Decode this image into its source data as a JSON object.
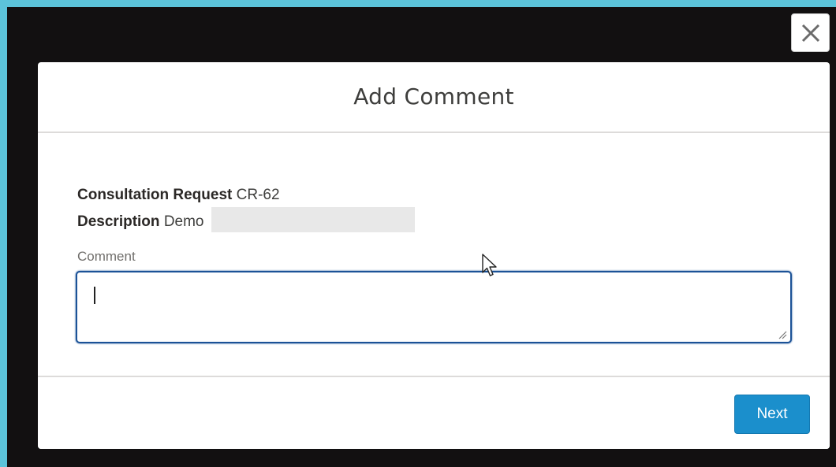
{
  "modal": {
    "title": "Add Comment",
    "close_icon": "close-icon"
  },
  "record": {
    "consultation_label": "Consultation Request",
    "consultation_value": "CR-62",
    "description_label": "Description",
    "description_value": "Demo"
  },
  "comment": {
    "label": "Comment",
    "value": ""
  },
  "footer": {
    "next_label": "Next"
  },
  "colors": {
    "frame_border": "#5cc3da",
    "overlay": "#121011",
    "input_focus": "#1b5297",
    "primary_button": "#1b8fcc"
  }
}
